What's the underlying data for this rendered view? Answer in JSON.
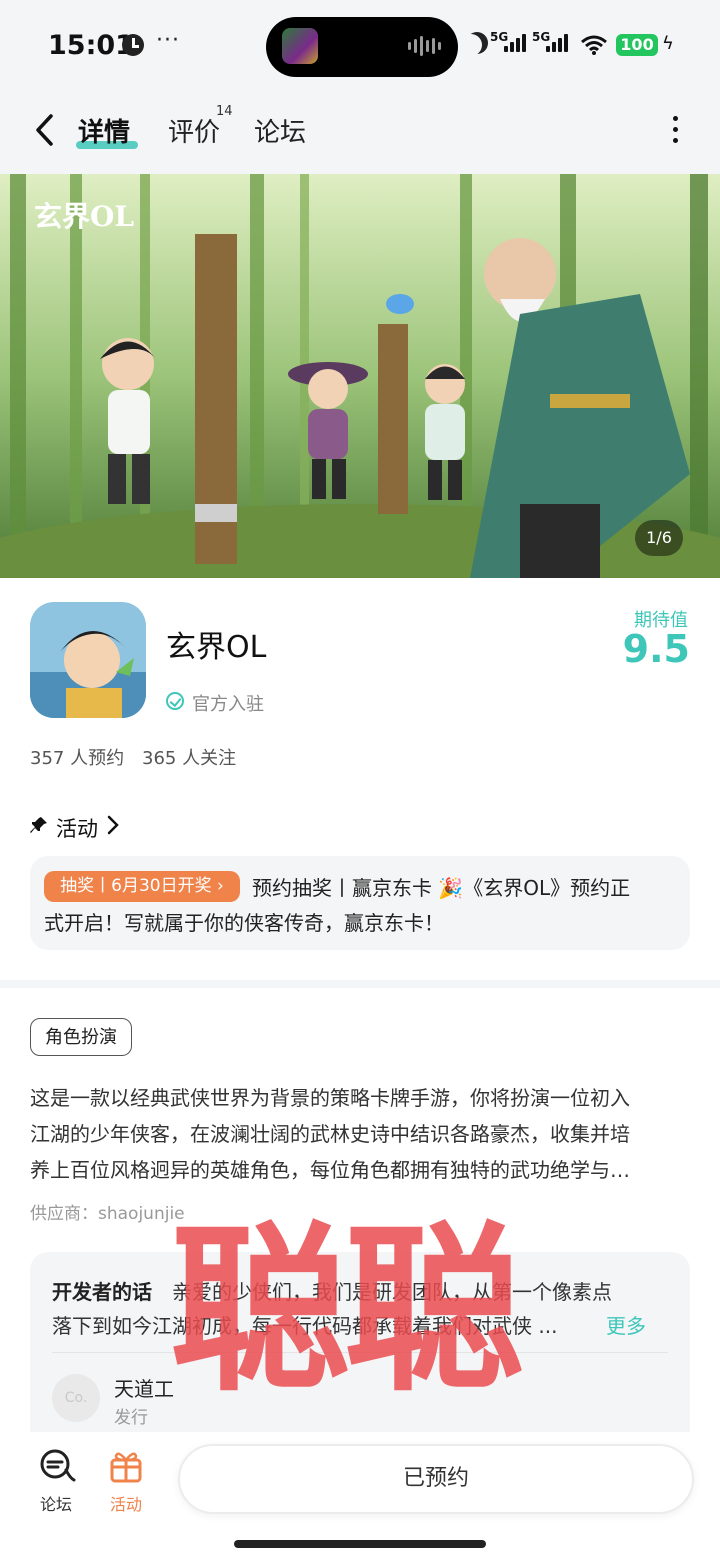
{
  "status_bar": {
    "time": "15:01",
    "dots": "···",
    "signal_1": "5G",
    "signal_2": "5G",
    "battery": "100"
  },
  "nav": {
    "tabs": [
      {
        "label": "详情",
        "active": true
      },
      {
        "label": "评价",
        "badge": "14"
      },
      {
        "label": "论坛"
      }
    ]
  },
  "hero": {
    "logo_text": "玄界OL",
    "counter": "1/6"
  },
  "app": {
    "name": "玄界OL",
    "verified_text": "官方入驻",
    "expect_label": "期待值",
    "expect_value": "9.5",
    "reservations": "357 人预约",
    "followers": "365 人关注"
  },
  "activity": {
    "title": "活动",
    "tag": "抽奖丨6月30日开奖 ›",
    "text_line1": "预约抽奖丨赢京东卡 🎉《玄界OL》预约正",
    "text_line2": "式开启！写就属于你的侠客传奇，赢京东卡！"
  },
  "details": {
    "genre": "角色扮演",
    "desc_lines": [
      "这是一款以经典武侠世界为背景的策略卡牌手游，你将扮演一位初入",
      "江湖的少年侠客，在波澜壮阔的武林史诗中结识各路豪杰，收集并培",
      "养上百位风格迥异的英雄角色，每位角色都拥有独特的武功绝学与…"
    ],
    "supplier": "供应商：shaojunjie"
  },
  "developer": {
    "label": "开发者的话",
    "text_line1": "亲爱的少侠们，我们是研发团队，从第一个像素点",
    "text_line2": "落下到如今江湖初成，每一行代码都承载着我们对武侠 ...",
    "more": "更多",
    "publisher_avatar": "Co.",
    "publisher_name": "天道工",
    "publisher_role": "发行"
  },
  "watermark": "聪聪",
  "bottom_bar": {
    "forum_label": "论坛",
    "activity_label": "活动",
    "reserve_button": "已预约"
  },
  "colors": {
    "accent": "#3ec6b9",
    "orange": "#f0834a",
    "watermark": "#ea4c50"
  }
}
